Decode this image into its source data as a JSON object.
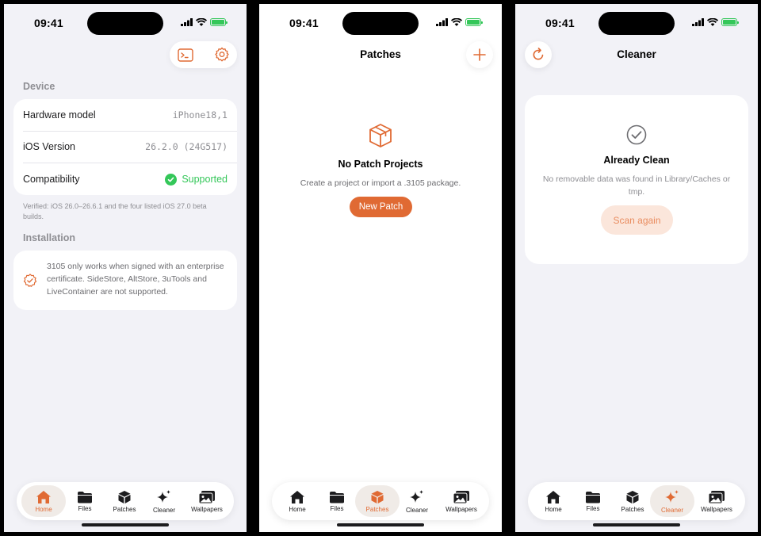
{
  "status": {
    "time": "09:41"
  },
  "home": {
    "device_section": "Device",
    "rows": [
      {
        "label": "Hardware model",
        "value": "iPhone18,1"
      },
      {
        "label": "iOS Version",
        "value": "26.2.0 (24G517)"
      },
      {
        "label": "Compatibility",
        "value": "Supported"
      }
    ],
    "verified_note": "Verified: iOS 26.0–26.6.1 and the four listed iOS 27.0 beta builds.",
    "installation_section": "Installation",
    "installation_text": "3105 only works when signed with an enterprise certificate. SideStore, AltStore, 3uTools and LiveContainer are not supported."
  },
  "patches": {
    "title": "Patches",
    "empty_title": "No Patch Projects",
    "empty_subtitle": "Create a project or import a .3105 package.",
    "new_button": "New Patch"
  },
  "cleaner": {
    "title": "Cleaner",
    "status_title": "Already Clean",
    "status_text": "No removable data was found in Library/Caches or tmp.",
    "scan_button": "Scan again"
  },
  "tabs": [
    {
      "label": "Home",
      "icon": "house-icon"
    },
    {
      "label": "Files",
      "icon": "folder-icon"
    },
    {
      "label": "Patches",
      "icon": "box-icon"
    },
    {
      "label": "Cleaner",
      "icon": "sparkles-icon"
    },
    {
      "label": "Wallpapers",
      "icon": "photos-icon"
    }
  ],
  "colors": {
    "accent": "#e06a33",
    "success": "#34c759",
    "background": "#f2f2f7"
  }
}
